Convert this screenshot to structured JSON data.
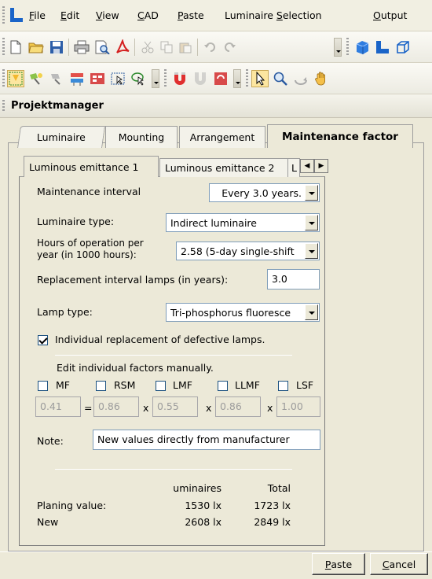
{
  "menu": {
    "items": [
      {
        "pre": "",
        "ul": "F",
        "post": "ile"
      },
      {
        "pre": "",
        "ul": "E",
        "post": "dit"
      },
      {
        "pre": "",
        "ul": "V",
        "post": "iew"
      },
      {
        "pre": "",
        "ul": "C",
        "post": "AD"
      },
      {
        "pre": "",
        "ul": "P",
        "post": "aste"
      },
      {
        "pre": "Luminaire ",
        "ul": "S",
        "post": "election"
      },
      {
        "pre": "",
        "ul": "O",
        "post": "utput"
      }
    ]
  },
  "project_manager": {
    "title": "Projektmanager"
  },
  "outer_tabs": [
    "Luminaire",
    "Mounting",
    "Arrangement",
    "Maintenance factor"
  ],
  "inner_tabs": [
    "Luminous emittance 1",
    "Luminous emittance 2",
    "L"
  ],
  "form": {
    "maintenance_interval_label": "Maintenance interval",
    "maintenance_interval_value": "Every 3.0 years.",
    "luminaire_type_label": "Luminaire type:",
    "luminaire_type_value": "Indirect luminaire",
    "hours_label_line1": "Hours of operation per",
    "hours_label_line2": "year (in 1000 hours):",
    "hours_value": "2.58 (5-day single-shift",
    "replacement_label": "Replacement interval lamps (in years):",
    "replacement_value": "3.0",
    "lamp_type_label": "Lamp type:",
    "lamp_type_value": "Tri-phosphorus fluoresce",
    "individual_replacement_label": "Individual replacement of defective lamps.",
    "individual_replacement_checked": true,
    "edit_factors_label": "Edit individual factors manually.",
    "factors": [
      {
        "label": "MF",
        "value": "0.41"
      },
      {
        "label": "RSM",
        "value": "0.86"
      },
      {
        "label": "LMF",
        "value": "0.55"
      },
      {
        "label": "LLMF",
        "value": "0.86"
      },
      {
        "label": "LSF",
        "value": "1.00"
      }
    ],
    "ops": [
      "=",
      "x",
      "x",
      "x"
    ],
    "note_label": "Note:",
    "note_value": "New values directly from manufacturer"
  },
  "results": {
    "col_luminaires": "uminaires",
    "col_total": "Total",
    "rows": [
      {
        "label": "Planing value:",
        "luminaires": "1530 lx",
        "total": "1723 lx"
      },
      {
        "label": "New",
        "luminaires": "2608 lx",
        "total": "2849 lx"
      }
    ]
  },
  "buttons": {
    "paste": {
      "ul": "P",
      "post": "aste"
    },
    "cancel": {
      "ul": "C",
      "post": "ancel"
    }
  }
}
